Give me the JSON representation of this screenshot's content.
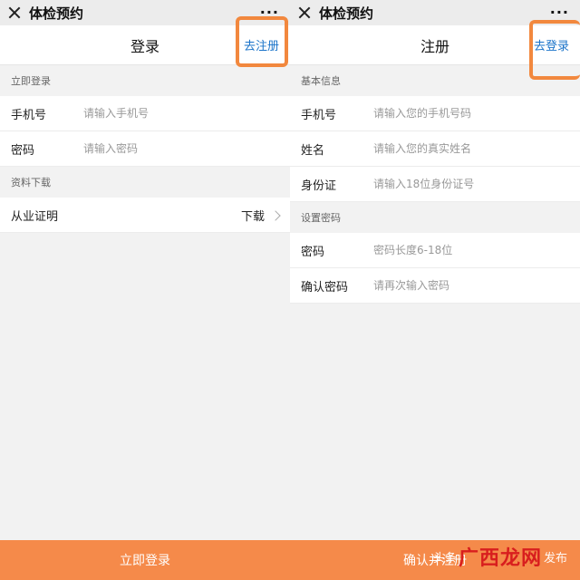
{
  "app": {
    "title": "体检预约",
    "more": "···"
  },
  "login": {
    "nav_title": "登录",
    "nav_link": "去注册",
    "section_login": "立即登录",
    "phone_label": "手机号",
    "phone_placeholder": "请输入手机号",
    "password_label": "密码",
    "password_placeholder": "请输入密码",
    "section_download": "资料下载",
    "certificate_label": "从业证明",
    "download_action": "下载",
    "submit": "立即登录"
  },
  "register": {
    "nav_title": "注册",
    "nav_link": "去登录",
    "section_basic": "基本信息",
    "phone_label": "手机号",
    "phone_placeholder": "请输入您的手机号码",
    "name_label": "姓名",
    "name_placeholder": "请输入您的真实姓名",
    "id_label": "身份证",
    "id_placeholder": "请输入18位身份证号",
    "section_password": "设置密码",
    "password_label": "密码",
    "password_placeholder": "密码长度6-18位",
    "confirm_label": "确认密码",
    "confirm_placeholder": "请再次输入密码",
    "submit": "确认并注册"
  },
  "watermark": {
    "small": "头条",
    "big": "广西龙网",
    "tail": "发布"
  },
  "colors": {
    "accent": "#f58a4a",
    "link": "#1a73c9",
    "highlight": "#f2883e"
  }
}
